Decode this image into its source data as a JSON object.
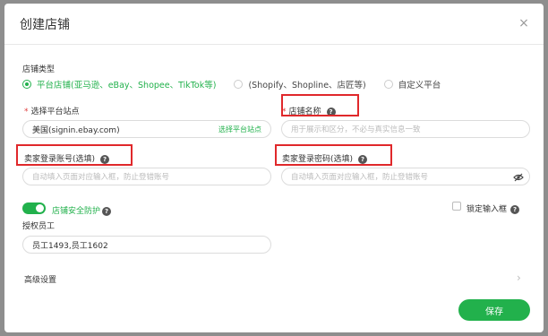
{
  "modal": {
    "title": "创建店铺",
    "close_glyph": "×"
  },
  "store_type": {
    "label": "店铺类型",
    "options": [
      {
        "label": "平台店铺(亚马逊、eBay、Shopee、TikTok等)",
        "checked": true
      },
      {
        "label": "(Shopify、Shopline、店匠等)",
        "checked": false
      },
      {
        "label": "自定义平台",
        "checked": false
      }
    ]
  },
  "platform_site": {
    "required_mark": "*",
    "label": "选择平台站点",
    "value": "美国(signin.ebay.com)",
    "link": "选择平台站点"
  },
  "store_name": {
    "required_mark": "*",
    "label": "店铺名称",
    "help": "?",
    "placeholder": "用于展示和区分，不必与真实信息一致"
  },
  "seller_account": {
    "label": "卖家登录账号(选填)",
    "help": "?",
    "placeholder": "自动填入页面对应输入框，防止登错账号"
  },
  "seller_password": {
    "label": "卖家登录密码(选填)",
    "help": "?",
    "placeholder": "自动填入页面对应输入框，防止登错账号"
  },
  "security": {
    "label": "店铺安全防护",
    "help": "?",
    "enabled": true
  },
  "lock_input": {
    "label": "锁定输入框",
    "help": "?",
    "checked": false
  },
  "authorized_staff": {
    "label": "授权员工",
    "value": "员工1493,员工1602"
  },
  "advanced": {
    "label": "高级设置",
    "chevron": "›"
  },
  "save_label": "保存",
  "colors": {
    "accent": "#22b14c",
    "highlight_box": "#e0282b"
  }
}
